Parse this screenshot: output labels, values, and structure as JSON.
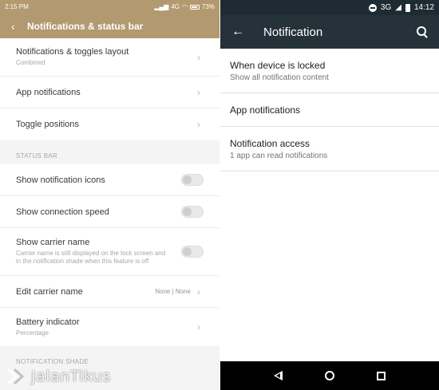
{
  "left_phone": {
    "status_bar": {
      "time": "2:15 PM",
      "network": "4G",
      "battery": "73%"
    },
    "toolbar": {
      "title": "Notifications & status bar"
    },
    "top_items": [
      {
        "title": "Notifications & toggles layout",
        "subtitle": "Combined"
      },
      {
        "title": "App notifications"
      },
      {
        "title": "Toggle positions"
      }
    ],
    "status_bar_section": {
      "header": "STATUS BAR",
      "items": [
        {
          "title": "Show notification icons",
          "toggle": false
        },
        {
          "title": "Show connection speed",
          "toggle": false
        },
        {
          "title": "Show carrier name",
          "subtitle": "Carrier name is still displayed on the lock screen and in the notification shade when this feature is off",
          "toggle": false
        },
        {
          "title": "Edit carrier name",
          "value": "None | None"
        },
        {
          "title": "Battery indicator",
          "subtitle": "Percentage"
        }
      ]
    },
    "notification_shade_section": {
      "header": "NOTIFICATION SHADE"
    }
  },
  "right_phone": {
    "status_bar": {
      "network": "3G",
      "time": "14:12"
    },
    "toolbar": {
      "title": "Notification"
    },
    "items": [
      {
        "title": "When device is locked",
        "subtitle": "Show all notification content"
      },
      {
        "title": "App notifications"
      },
      {
        "title": "Notification access",
        "subtitle": "1 app can read notifications"
      }
    ]
  },
  "watermark": {
    "text": "JalanTikus"
  },
  "icons": {
    "back": "back-arrow-icon",
    "chevron": "chevron-right-icon",
    "search": "search-icon",
    "nav": [
      "nav-back-icon",
      "nav-home-icon",
      "nav-recents-icon"
    ]
  },
  "colors": {
    "miui_header": "#b2996f",
    "android_toolbar": "#26323a",
    "android_status": "#1e2b32"
  }
}
